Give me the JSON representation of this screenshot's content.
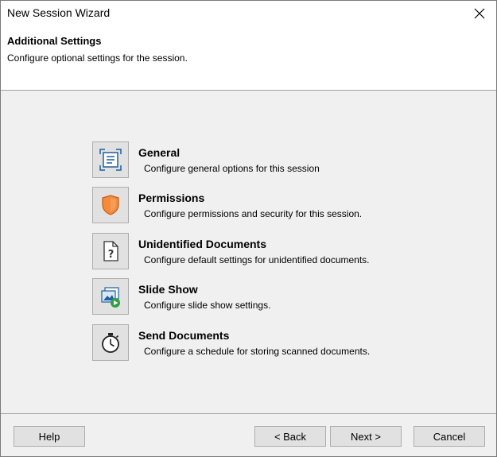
{
  "window": {
    "title": "New Session Wizard"
  },
  "header": {
    "title": "Additional Settings",
    "subtitle": "Configure optional settings for the session."
  },
  "options": [
    {
      "title": "General",
      "description": "Configure general options for this session",
      "icon": "general-settings-icon"
    },
    {
      "title": "Permissions",
      "description": "Configure permissions and security for this session.",
      "icon": "shield-icon"
    },
    {
      "title": "Unidentified Documents",
      "description": "Configure default settings for unidentified documents.",
      "icon": "question-document-icon"
    },
    {
      "title": "Slide Show",
      "description": "Configure slide show settings.",
      "icon": "slideshow-icon"
    },
    {
      "title": "Send Documents",
      "description": "Configure a schedule for storing scanned documents.",
      "icon": "stopwatch-icon"
    }
  ],
  "footer": {
    "help_label": "Help",
    "back_label": "< Back",
    "next_label": "Next >",
    "cancel_label": "Cancel"
  },
  "colors": {
    "content_background": "#f0f0f0",
    "button_face": "#e1e1e1",
    "button_border": "#adadad",
    "shield_orange": "#f28c3c",
    "icon_blue": "#1f5f9e",
    "play_green": "#2ea043"
  }
}
